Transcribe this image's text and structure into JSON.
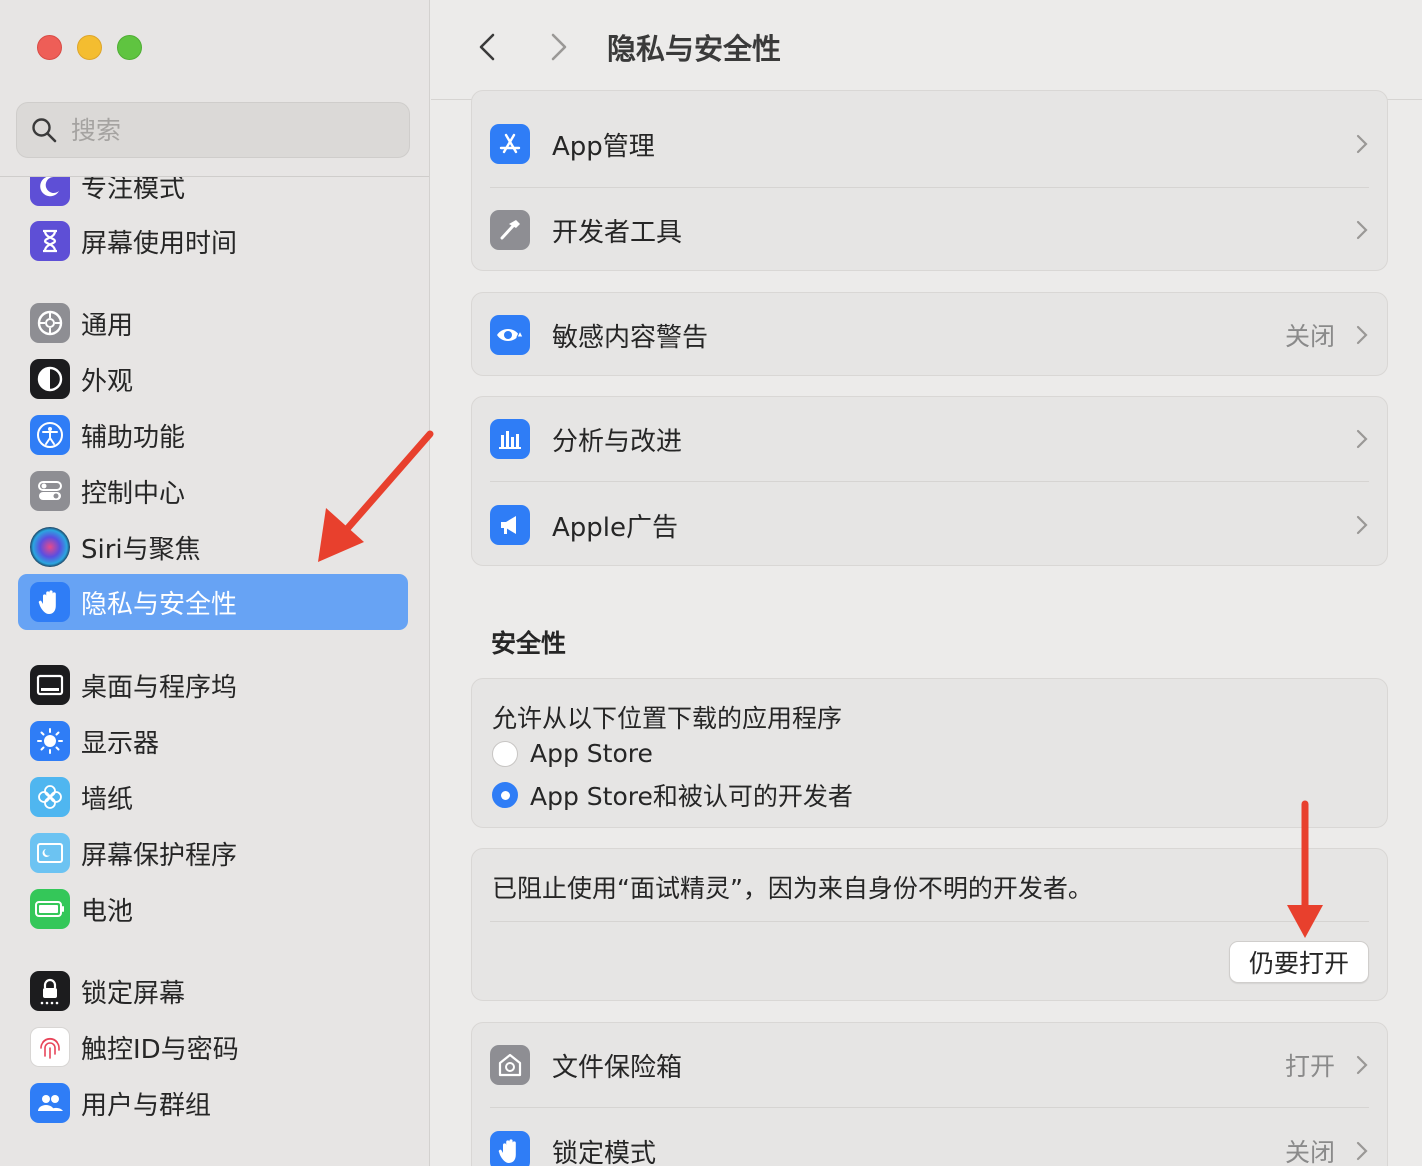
{
  "window": {
    "title": "隐私与安全性"
  },
  "search": {
    "placeholder": "搜索"
  },
  "sidebar": {
    "items": [
      {
        "label": "专注模式",
        "icon": "moon-icon",
        "color": "#5e4fd6"
      },
      {
        "label": "屏幕使用时间",
        "icon": "hourglass-icon",
        "color": "#5e4fd6"
      },
      {
        "label": "通用",
        "icon": "gear-icon",
        "color": "#8e8e93"
      },
      {
        "label": "外观",
        "icon": "appearance-icon",
        "color": "#1c1c1e"
      },
      {
        "label": "辅助功能",
        "icon": "accessibility-icon",
        "color": "#2f7df6"
      },
      {
        "label": "控制中心",
        "icon": "toggle-icon",
        "color": "#8e8e93"
      },
      {
        "label": "Siri与聚焦",
        "icon": "siri-icon",
        "color": "#2b2b5e"
      },
      {
        "label": "隐私与安全性",
        "icon": "hand-icon",
        "color": "#2f7df6",
        "selected": true
      },
      {
        "label": "桌面与程序坞",
        "icon": "dock-icon",
        "color": "#1c1c1e"
      },
      {
        "label": "显示器",
        "icon": "sun-icon",
        "color": "#2f7df6"
      },
      {
        "label": "墙纸",
        "icon": "flower-icon",
        "color": "#4fb6f0"
      },
      {
        "label": "屏幕保护程序",
        "icon": "screensaver-icon",
        "color": "#6cc3f2"
      },
      {
        "label": "电池",
        "icon": "battery-icon",
        "color": "#34c759"
      },
      {
        "label": "锁定屏幕",
        "icon": "lock-icon",
        "color": "#1c1c1e"
      },
      {
        "label": "触控ID与密码",
        "icon": "fingerprint-icon",
        "color": "#ffffff"
      },
      {
        "label": "用户与群组",
        "icon": "users-icon",
        "color": "#2f7df6"
      }
    ]
  },
  "main": {
    "group1": [
      {
        "label": "App管理",
        "icon": "app-store-icon"
      },
      {
        "label": "开发者工具",
        "icon": "hammer-icon"
      }
    ],
    "group2": [
      {
        "label": "敏感内容警告",
        "value": "关闭",
        "icon": "eye-warning-icon"
      }
    ],
    "group3": [
      {
        "label": "分析与改进",
        "icon": "chart-icon"
      },
      {
        "label": "Apple广告",
        "icon": "megaphone-icon"
      }
    ],
    "security": {
      "title": "安全性",
      "allow_label": "允许从以下位置下载的应用程序",
      "options": [
        {
          "label": "App Store",
          "selected": false
        },
        {
          "label": "App Store和被认可的开发者",
          "selected": true
        }
      ],
      "blocked_message": "已阻止使用“面试精灵”，因为来自身份不明的开发者。",
      "open_anyway": "仍要打开"
    },
    "group4": [
      {
        "label": "文件保险箱",
        "value": "打开",
        "icon": "vault-icon"
      },
      {
        "label": "锁定模式",
        "value": "关闭",
        "icon": "hand-icon"
      }
    ]
  },
  "colors": {
    "accent": "#2f7df6",
    "selection": "#67a3f4",
    "annotation_arrow": "#e8402d"
  }
}
